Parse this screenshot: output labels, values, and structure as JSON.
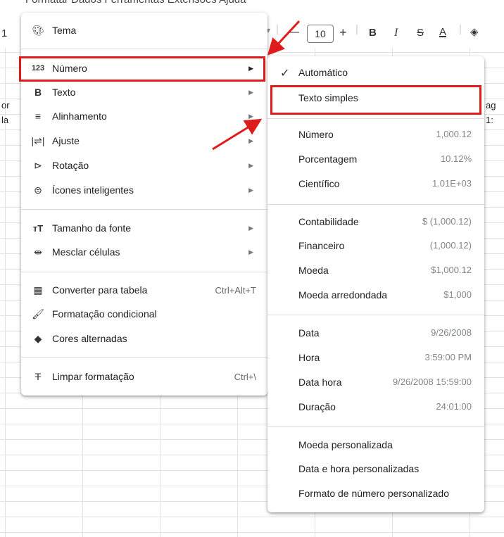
{
  "menubar_text": "Formatar   Dados   Ferramentas   Extensões   Ajuda",
  "toolbar": {
    "left_fragment": "1",
    "font_size": "10",
    "minus": "—",
    "plus": "+",
    "bold": "B",
    "italic": "I",
    "strike": "S",
    "text_color": "A"
  },
  "sheet_fragments": [
    "or",
    "la",
    "ag",
    "1:"
  ],
  "format_menu": {
    "tema": "Tema",
    "numero": "Número",
    "texto": "Texto",
    "alinhamento": "Alinhamento",
    "ajuste": "Ajuste",
    "rotacao": "Rotação",
    "icones": "Ícones inteligentes",
    "tamanho": "Tamanho da fonte",
    "mesclar": "Mesclar células",
    "converter": "Converter para tabela",
    "converter_shortcut": "Ctrl+Alt+T",
    "condicional": "Formatação condicional",
    "cores": "Cores alternadas",
    "limpar": "Limpar formatação",
    "limpar_shortcut": "Ctrl+\\"
  },
  "number_submenu": {
    "automatico": "Automático",
    "texto_simples": "Texto simples",
    "rows": [
      {
        "label": "Número",
        "value": "1,000.12"
      },
      {
        "label": "Porcentagem",
        "value": "10.12%"
      },
      {
        "label": "Científico",
        "value": "1.01E+03"
      },
      {
        "label": "Contabilidade",
        "value": "$ (1,000.12)"
      },
      {
        "label": "Financeiro",
        "value": "(1,000.12)"
      },
      {
        "label": "Moeda",
        "value": "$1,000.12"
      },
      {
        "label": "Moeda arredondada",
        "value": "$1,000"
      },
      {
        "label": "Data",
        "value": "9/26/2008"
      },
      {
        "label": "Hora",
        "value": "3:59:00 PM"
      },
      {
        "label": "Data hora",
        "value": "9/26/2008 15:59:00"
      },
      {
        "label": "Duração",
        "value": "24:01:00"
      }
    ],
    "moeda_personalizada": "Moeda personalizada",
    "data_hora_personalizadas": "Data e hora personalizadas",
    "formato_personalizado": "Formato de número personalizado"
  },
  "colors": {
    "highlight": "#e01b1b"
  }
}
